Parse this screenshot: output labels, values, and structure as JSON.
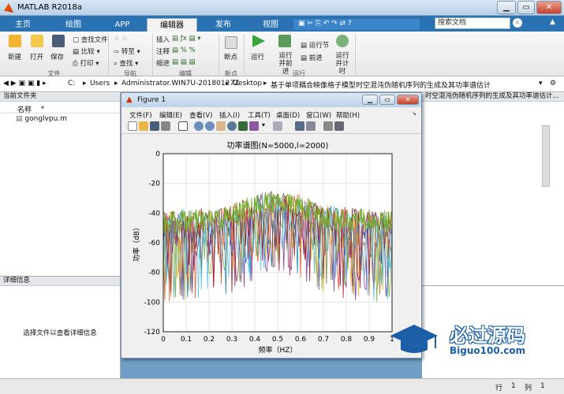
{
  "window": {
    "title": "MATLAB R2018a",
    "minimize": "▁",
    "maximize": "▭",
    "close": "✕"
  },
  "tabs": [
    "主页",
    "绘图",
    "APP",
    "编辑器",
    "发布",
    "视图"
  ],
  "search": {
    "placeholder": "搜索文档"
  },
  "ribbon": {
    "file": {
      "new": "新建",
      "open": "打开",
      "save": "保存",
      "find_files": "查找文件",
      "compare": "比较",
      "print": "打印",
      "group": "文件"
    },
    "navigate": {
      "goto": "转至",
      "find": "查找",
      "group": "导航"
    },
    "edit": {
      "insert": "插入",
      "comment": "注释",
      "indent": "缩进",
      "group": "编辑"
    },
    "breakpoints": {
      "label": "断点",
      "group": "断点"
    },
    "run": {
      "run": "运行",
      "run_advance": "运行并前进",
      "run_section": "运行节",
      "advance": "前进",
      "run_time": "运行并计时",
      "group": "运行"
    }
  },
  "address": {
    "path": [
      "C:",
      "Users",
      "Administrator.WIN7U-20180127Z",
      "Desktop",
      "基于单项耦合映像格子模型时空混沌伪随机序列的生成及其功率谱估计"
    ]
  },
  "current_folder": {
    "title": "当前文件夹",
    "column": "名称",
    "files": [
      "gonglvpu.m"
    ]
  },
  "details": {
    "title": "详细信息",
    "message": "选择文件以查看详细信息"
  },
  "right_panel": {
    "title": "时空混沌伪随机序列的生成及其功率谱估计..."
  },
  "figure": {
    "title": "Figure 1",
    "menu": [
      "文件(F)",
      "编辑(E)",
      "查看(V)",
      "插入(I)",
      "工具(T)",
      "桌面(D)",
      "窗口(W)",
      "帮助(H)"
    ]
  },
  "status": {
    "row_label": "行",
    "row": "1",
    "col_label": "列",
    "col": "1"
  },
  "watermark": {
    "line1": "必过源码",
    "line2": "Biguo100.com"
  },
  "colors": {
    "matlab_blue": "#2b72b3",
    "series": [
      "#0072bd",
      "#d95319",
      "#edb120",
      "#7e2f8e",
      "#77ac30",
      "#4dbeee",
      "#a2142f"
    ]
  },
  "chart_data": {
    "type": "line",
    "title": "功率谱图(N=5000,l=2000)",
    "xlabel": "频率（HZ）",
    "ylabel": "功率（dB）",
    "xlim": [
      0,
      1
    ],
    "ylim": [
      -120,
      0
    ],
    "xticks": [
      0,
      0.1,
      0.2,
      0.3,
      0.4,
      0.5,
      0.6,
      0.7,
      0.8,
      0.9,
      1
    ],
    "yticks": [
      0,
      -20,
      -40,
      -60,
      -80,
      -100,
      -120
    ],
    "xtick_labels": [
      "0",
      "0.1",
      "0.2",
      "0.3",
      "0.4",
      "0.5",
      "0.6",
      "0.7",
      "0.8",
      "0.9",
      "1"
    ],
    "ytick_labels": [
      "0",
      "-20",
      "-40",
      "-60",
      "-80",
      "-100",
      "-120"
    ],
    "grid": true,
    "envelope": {
      "x": [
        0,
        0.1,
        0.2,
        0.3,
        0.35,
        0.4,
        0.45,
        0.5,
        0.55,
        0.6,
        0.65,
        0.7,
        0.8,
        0.9,
        1
      ],
      "upper": [
        -38,
        -37,
        -36,
        -34,
        -30,
        -27,
        -25,
        -25,
        -26,
        -28,
        -31,
        -34,
        -36,
        -37,
        -38
      ],
      "mid": [
        -55,
        -54,
        -53,
        -50,
        -46,
        -42,
        -40,
        -40,
        -41,
        -43,
        -47,
        -50,
        -53,
        -54,
        -55
      ],
      "lower": [
        -100,
        -100,
        -98,
        -95,
        -90,
        -85,
        -80,
        -80,
        -82,
        -86,
        -90,
        -95,
        -98,
        -100,
        -100
      ]
    }
  }
}
